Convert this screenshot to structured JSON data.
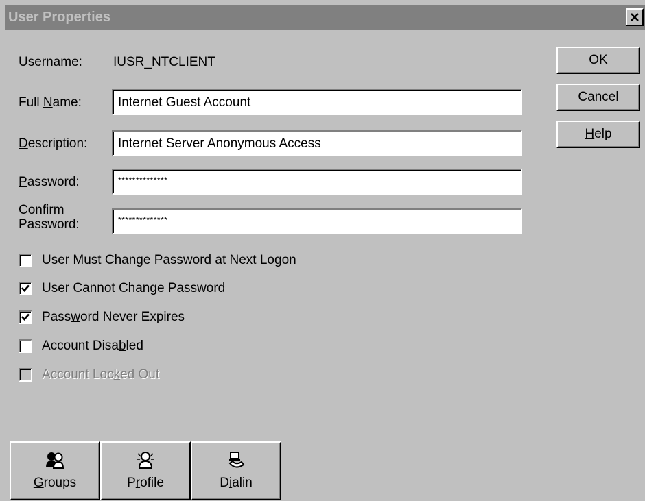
{
  "window": {
    "title": "User Properties"
  },
  "fields": {
    "username_label": "Username:",
    "username_value": "IUSR_NTCLIENT",
    "fullname_label_pre": "Full ",
    "fullname_label_u": "N",
    "fullname_label_post": "ame:",
    "fullname_value": "Internet Guest Account",
    "description_label_u": "D",
    "description_label_post": "escription:",
    "description_value": "Internet Server Anonymous Access",
    "password_label_u": "P",
    "password_label_post": "assword:",
    "password_value": "**************",
    "confirm_label_u": "C",
    "confirm_label_line1_post": "onfirm",
    "confirm_label_line2": "Password:",
    "confirm_value": "**************"
  },
  "buttons": {
    "ok": "OK",
    "cancel": "Cancel",
    "help_u": "H",
    "help_post": "elp"
  },
  "checkboxes": [
    {
      "pre": "User ",
      "u": "M",
      "post": "ust Change Password at Next Logon",
      "checked": false,
      "enabled": true
    },
    {
      "pre": "U",
      "u": "s",
      "post": "er Cannot Change Password",
      "checked": true,
      "enabled": true
    },
    {
      "pre": "Pass",
      "u": "w",
      "post": "ord Never Expires",
      "checked": true,
      "enabled": true
    },
    {
      "pre": "Account Disa",
      "u": "b",
      "post": "led",
      "checked": false,
      "enabled": true
    },
    {
      "pre": "Account Loc",
      "u": "k",
      "post": "ed Out",
      "checked": false,
      "enabled": false
    }
  ],
  "bottom_buttons": [
    {
      "pre": "",
      "u": "G",
      "post": "roups",
      "icon": "groups-icon"
    },
    {
      "pre": "P",
      "u": "r",
      "post": "ofile",
      "icon": "profile-icon"
    },
    {
      "pre": "D",
      "u": "i",
      "post": "alin",
      "icon": "dialin-icon"
    }
  ],
  "colors": {
    "face": "#c0c0c0",
    "title_inactive": "#808080",
    "disabled_text": "#808080"
  }
}
